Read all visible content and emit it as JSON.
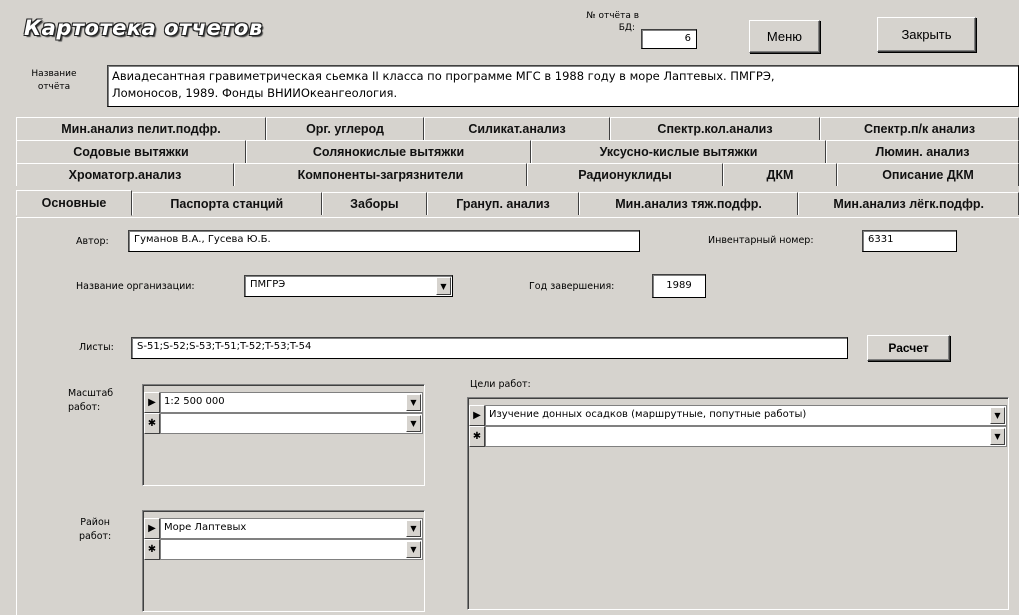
{
  "header": {
    "title": "Картотека отчетов",
    "report_no_label_line1": "№ отчёта в",
    "report_no_label_line2": "БД:",
    "report_no_value": "6",
    "menu_button": "Меню",
    "close_button": "Закрыть"
  },
  "report_name": {
    "label_line1": "Название",
    "label_line2": "отчёта",
    "value_line1": "Авиадесантная гравиметрическая сьемка II  класса по программе МГС в 1988 году в море Лаптевых. ПМГРЭ,",
    "value_line2": "Ломоносов, 1989. Фонды ВНИИОкеангеология."
  },
  "tabs": {
    "row1": [
      "Мин.анализ пелит.подфр.",
      "Орг. углерод",
      "Силикат.анализ",
      "Спектр.кол.анализ",
      "Спектр.п/к анализ"
    ],
    "row2": [
      "Содовые вытяжки",
      "Солянокислые вытяжки",
      "Уксусно-кислые вытяжки",
      "Люмин. анализ"
    ],
    "row3": [
      "Хроматогр.анализ",
      "Компоненты-загрязнители",
      "Радионуклиды",
      "ДКМ",
      "Описание ДКМ"
    ],
    "row4": [
      "Основные",
      "Паспорта станций",
      "Заборы",
      "Грануп. анализ",
      "Мин.анализ тяж.подфр.",
      "Мин.анализ лёгк.подфр."
    ],
    "active": "Основные"
  },
  "main": {
    "author_label": "Автор:",
    "author_value": "Гуманов В.А., Гусева Ю.Б.",
    "inventory_label": "Инвентарный номер:",
    "inventory_value": "6331",
    "org_label": "Название организации:",
    "org_value": "ПМГРЭ",
    "year_label": "Год завершения:",
    "year_value": "1989",
    "sheets_label": "Листы:",
    "sheets_value": "S-51;S-52;S-53;T-51;T-52;T-53;T-54",
    "calc_button": "Расчет",
    "scale_label_line1": "Масштаб",
    "scale_label_line2": "работ:",
    "scale_value": "1:2 500 000",
    "goals_label": "Цели работ:",
    "goals_value": "Изучение донных осадков (маршрутные, попутные работы)",
    "region_label_line1": "Район",
    "region_label_line2": "работ:",
    "region_value": "Море Лаптевых",
    "current_record_marker": "▶",
    "new_record_marker": "✱"
  }
}
